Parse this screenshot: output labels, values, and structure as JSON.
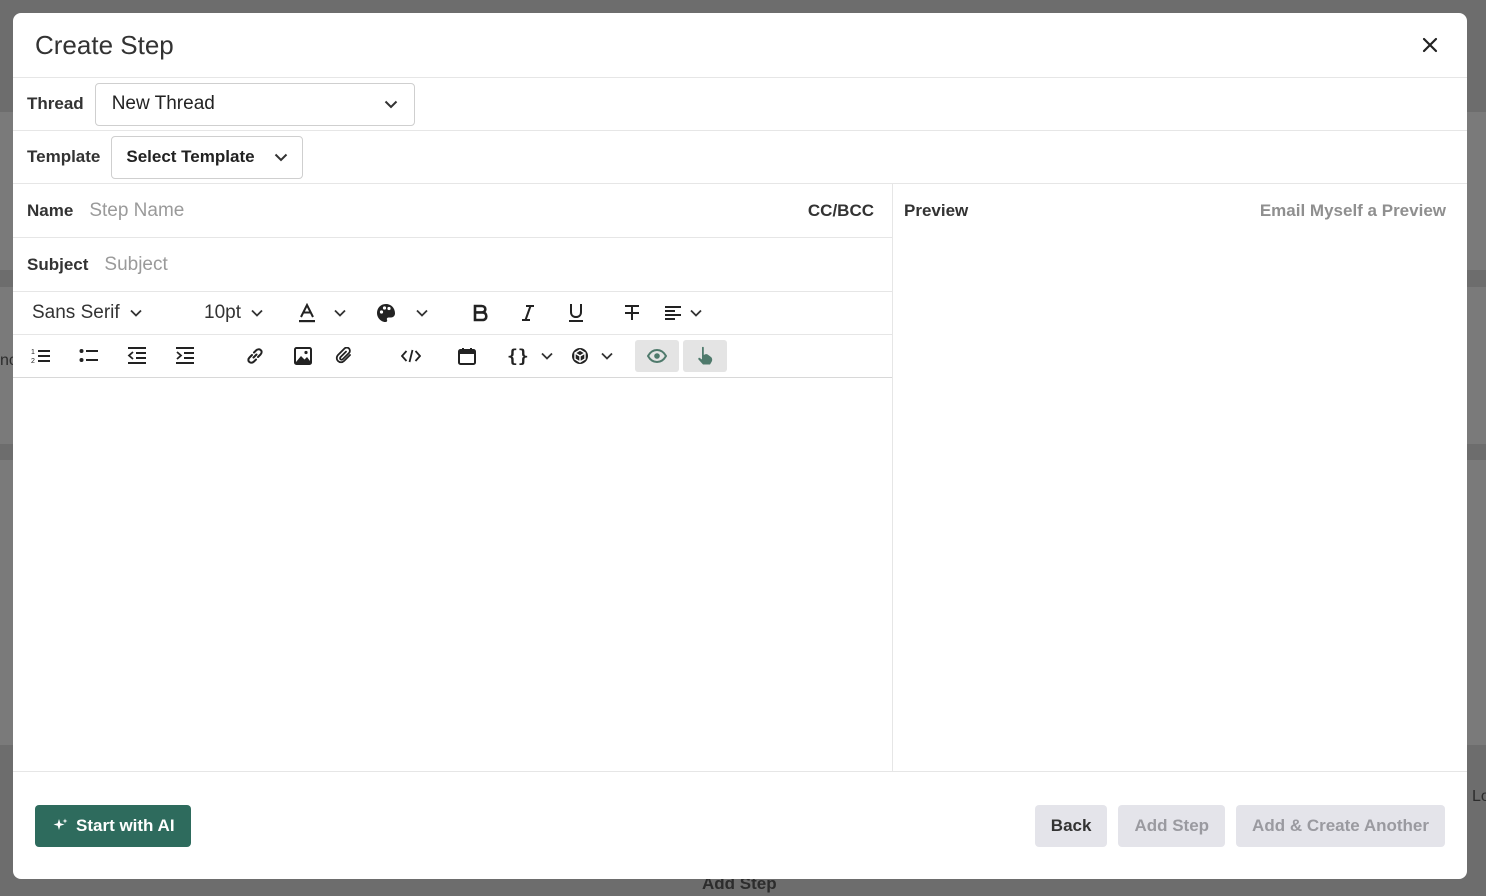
{
  "background": {
    "bottom_button": "Add Step",
    "edge_left": "nc",
    "edge_right": "Lo"
  },
  "modal": {
    "title": "Create Step",
    "thread": {
      "label": "Thread",
      "value": "New Thread"
    },
    "template": {
      "label": "Template",
      "value": "Select Template"
    },
    "name": {
      "label": "Name",
      "placeholder": "Step Name",
      "cc_bcc": "CC/BCC"
    },
    "subject": {
      "label": "Subject",
      "placeholder": "Subject"
    },
    "toolbar": {
      "font_family": "Sans Serif",
      "font_size": "10pt",
      "icons_row1": [
        "text-color-icon",
        "palette-icon",
        "bold-icon",
        "italic-icon",
        "underline-icon",
        "strikethrough-icon",
        "align-left-icon"
      ],
      "icons_row2": [
        "ordered-list-icon",
        "bullet-list-icon",
        "outdent-icon",
        "indent-icon",
        "link-icon",
        "image-icon",
        "attachment-icon",
        "code-icon",
        "calendar-icon",
        "variables-icon",
        "cube-icon",
        "eye-icon",
        "pointer-hand-icon"
      ]
    },
    "preview": {
      "title": "Preview",
      "email_preview_link": "Email Myself a Preview"
    },
    "footer": {
      "start_ai": "Start with AI",
      "back": "Back",
      "add_step": "Add Step",
      "add_create_another": "Add & Create Another"
    },
    "colors": {
      "accent": "#2e6b5d",
      "active_icon": "#4f7a6c"
    }
  }
}
